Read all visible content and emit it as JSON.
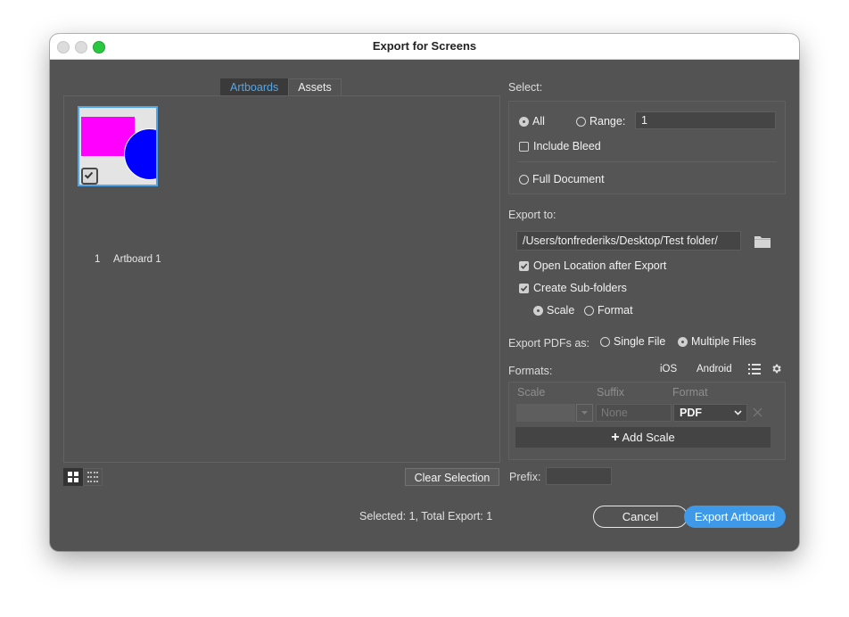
{
  "window": {
    "title": "Export for Screens"
  },
  "tabs": [
    {
      "label": "Artboards",
      "active": true
    },
    {
      "label": "Assets",
      "active": false
    }
  ],
  "artboards": [
    {
      "number": "1",
      "name": "Artboard 1",
      "selected": true,
      "thumbnail_colors": {
        "background": "#e4e4e4",
        "rectangle": "#ff00ff",
        "circle": "#0000ff"
      }
    }
  ],
  "view_buttons": [
    {
      "icon": "grid-view-icon",
      "active": true
    },
    {
      "icon": "list-view-icon",
      "active": false
    }
  ],
  "clear_selection_label": "Clear Selection",
  "prefix": {
    "label": "Prefix:",
    "value": ""
  },
  "status": "Selected: 1, Total Export: 1",
  "select": {
    "label": "Select:",
    "all_label": "All",
    "all_checked": true,
    "range_label": "Range:",
    "range_checked": false,
    "range_value": "1",
    "include_bleed_label": "Include Bleed",
    "include_bleed_checked": false,
    "full_document_label": "Full Document",
    "full_document_checked": false
  },
  "export_to": {
    "label": "Export to:",
    "path": "/Users/tonfrederiks/Desktop/Test folder/",
    "open_location_label": "Open Location after Export",
    "open_location_checked": true,
    "create_subfolders_label": "Create Sub-folders",
    "create_subfolders_checked": true,
    "scale_label": "Scale",
    "scale_checked": true,
    "format_label": "Format",
    "format_checked": false
  },
  "export_pdfs": {
    "label": "Export PDFs as:",
    "single_file_label": "Single File",
    "single_file_checked": false,
    "multiple_files_label": "Multiple Files",
    "multiple_files_checked": true
  },
  "formats": {
    "label": "Formats:",
    "ios_label": "iOS",
    "android_label": "Android",
    "columns": [
      "Scale",
      "Suffix",
      "Format"
    ],
    "rows": [
      {
        "scale": "",
        "suffix_placeholder": "None",
        "format": "PDF"
      }
    ],
    "add_scale_label": "Add Scale"
  },
  "buttons": {
    "cancel": "Cancel",
    "export": "Export Artboard"
  },
  "colors": {
    "accent": "#3e9ae8",
    "tab_active_text": "#4fa8ee",
    "panel_bg": "#535353"
  }
}
